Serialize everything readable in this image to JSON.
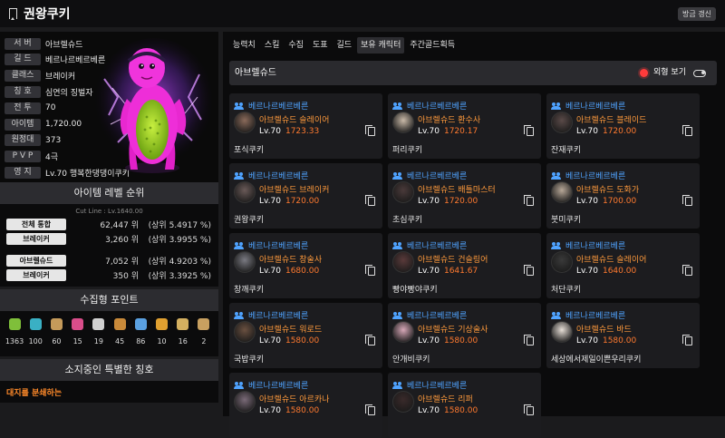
{
  "header": {
    "title": "권왕쿠키",
    "refresh_label": "방금 갱신"
  },
  "profile": {
    "rows": [
      {
        "label": "서 버",
        "value": "아브렐슈드"
      },
      {
        "label": "길 드",
        "value": "베르나르베르베른"
      },
      {
        "label": "클래스",
        "value": "브레이커"
      },
      {
        "label": "칭 호",
        "value": "심연의 징벌자"
      },
      {
        "label": "전 투",
        "value": "70"
      },
      {
        "label": "아이템",
        "value": "1,720.00"
      },
      {
        "label": "원정대",
        "value": "373"
      },
      {
        "label": "P V P",
        "value": "4극"
      },
      {
        "label": "영 지",
        "value": "Lv.70 행복한댕댕이쿠키"
      }
    ]
  },
  "ranking": {
    "title": "아이템 레벨 순위",
    "cutline": "Cut Line : Lv.1640.00",
    "rows": [
      {
        "tag": "전체 통합",
        "pos": "62,447 위",
        "pct": "(상위 5.4917 %)"
      },
      {
        "tag": "브레이커",
        "pos": "3,260 위",
        "pct": "(상위 3.9955 %)"
      },
      {
        "tag": "아브렐슈드",
        "pos": "7,052 위",
        "pct": "(상위 4.9203 %)"
      },
      {
        "tag": "브레이커",
        "pos": "350 위",
        "pct": "(상위 3.3925 %)"
      }
    ]
  },
  "collection": {
    "title": "수집형 포인트",
    "items": [
      {
        "icon": "seed-icon",
        "color": "#7fbf3a",
        "count": "1363"
      },
      {
        "icon": "island-icon",
        "color": "#3ab0c4",
        "count": "100"
      },
      {
        "icon": "painting-icon",
        "color": "#c49a5a",
        "count": "60"
      },
      {
        "icon": "heart-icon",
        "color": "#d94d8a",
        "count": "15"
      },
      {
        "icon": "mask-icon",
        "color": "#d0d0d0",
        "count": "19"
      },
      {
        "icon": "ship-icon",
        "color": "#c98a3a",
        "count": "45"
      },
      {
        "icon": "leaf-icon",
        "color": "#5aa0e0",
        "count": "86"
      },
      {
        "icon": "star-icon",
        "color": "#e0a030",
        "count": "10"
      },
      {
        "icon": "medal-icon",
        "color": "#d4b060",
        "count": "16"
      },
      {
        "icon": "map-icon",
        "color": "#c8a060",
        "count": "2"
      }
    ]
  },
  "special_titles": {
    "title": "소지중인 특별한 칭호",
    "first": "대지를 분쇄하는"
  },
  "tabs": [
    {
      "label": "능력치",
      "active": false
    },
    {
      "label": "스킬",
      "active": false
    },
    {
      "label": "수집",
      "active": false
    },
    {
      "label": "도표",
      "active": false
    },
    {
      "label": "길드",
      "active": false
    },
    {
      "label": "보유 캐릭터",
      "active": true
    },
    {
      "label": "주간골드획득",
      "active": false
    }
  ],
  "server_section": {
    "title": "아브렐슈드",
    "appearance_label": "외형 보기"
  },
  "characters": [
    {
      "guild": "베르나르베르베른",
      "server_class": "아브렐슈드 슬레이어",
      "lv": "Lv.70",
      "ilvl": "1723.33",
      "name": "포식쿠키",
      "tint": "#8a6a5a"
    },
    {
      "guild": "베르나르베르베른",
      "server_class": "아브렐슈드 환수사",
      "lv": "Lv.70",
      "ilvl": "1720.17",
      "name": "퍼리쿠키",
      "tint": "#c9b9a8"
    },
    {
      "guild": "베르나르베르베른",
      "server_class": "아브렐슈드 블레이드",
      "lv": "Lv.70",
      "ilvl": "1720.00",
      "name": "잔재쿠키",
      "tint": "#5a4a48"
    },
    {
      "guild": "베르나르베르베른",
      "server_class": "아브렐슈드 브레이커",
      "lv": "Lv.70",
      "ilvl": "1720.00",
      "name": "권왕쿠키",
      "tint": "#6a5a58"
    },
    {
      "guild": "베르나르베르베른",
      "server_class": "아브렐슈드 배틀마스터",
      "lv": "Lv.70",
      "ilvl": "1720.00",
      "name": "초심쿠키",
      "tint": "#4a3a3a"
    },
    {
      "guild": "베르나르베르베른",
      "server_class": "아브렐슈드 도화가",
      "lv": "Lv.70",
      "ilvl": "1700.00",
      "name": "붓미쿠키",
      "tint": "#b8a898"
    },
    {
      "guild": "베르나르베르베른",
      "server_class": "아브렐슈드 창술사",
      "lv": "Lv.70",
      "ilvl": "1680.00",
      "name": "창깨쿠키",
      "tint": "#7a7a82"
    },
    {
      "guild": "베르나르베르베른",
      "server_class": "아브렐슈드 건슬링어",
      "lv": "Lv.70",
      "ilvl": "1641.67",
      "name": "빵야빵야쿠키",
      "tint": "#5a3a3a"
    },
    {
      "guild": "베르나르베르베른",
      "server_class": "아브렐슈드 슬레이어",
      "lv": "Lv.70",
      "ilvl": "1640.00",
      "name": "처단쿠키",
      "tint": "#3a3a3a"
    },
    {
      "guild": "베르나르베르베른",
      "server_class": "아브렐슈드 워로드",
      "lv": "Lv.70",
      "ilvl": "1580.00",
      "name": "국밥쿠키",
      "tint": "#6a5040"
    },
    {
      "guild": "베르나르베르베른",
      "server_class": "아브렐슈드 기상술사",
      "lv": "Lv.70",
      "ilvl": "1580.00",
      "name": "안개비쿠키",
      "tint": "#d8a8b8"
    },
    {
      "guild": "베르나르베르베른",
      "server_class": "아브렐슈드 바드",
      "lv": "Lv.70",
      "ilvl": "1580.00",
      "name": "세상에서제일이쁜우리쿠키",
      "tint": "#e8e0d8"
    },
    {
      "guild": "베르나르베르베른",
      "server_class": "아브렐슈드 아르카나",
      "lv": "Lv.70",
      "ilvl": "1580.00",
      "name": "",
      "tint": "#7a6a78"
    },
    {
      "guild": "베르나르베르베른",
      "server_class": "아브렐슈드 리퍼",
      "lv": "Lv.70",
      "ilvl": "1580.00",
      "name": "",
      "tint": "#3a2a2a"
    }
  ],
  "colors": {
    "accent_blue": "#4fa3ff",
    "accent_orange": "#ff7a2f",
    "title_orange": "#ff8a2a"
  }
}
